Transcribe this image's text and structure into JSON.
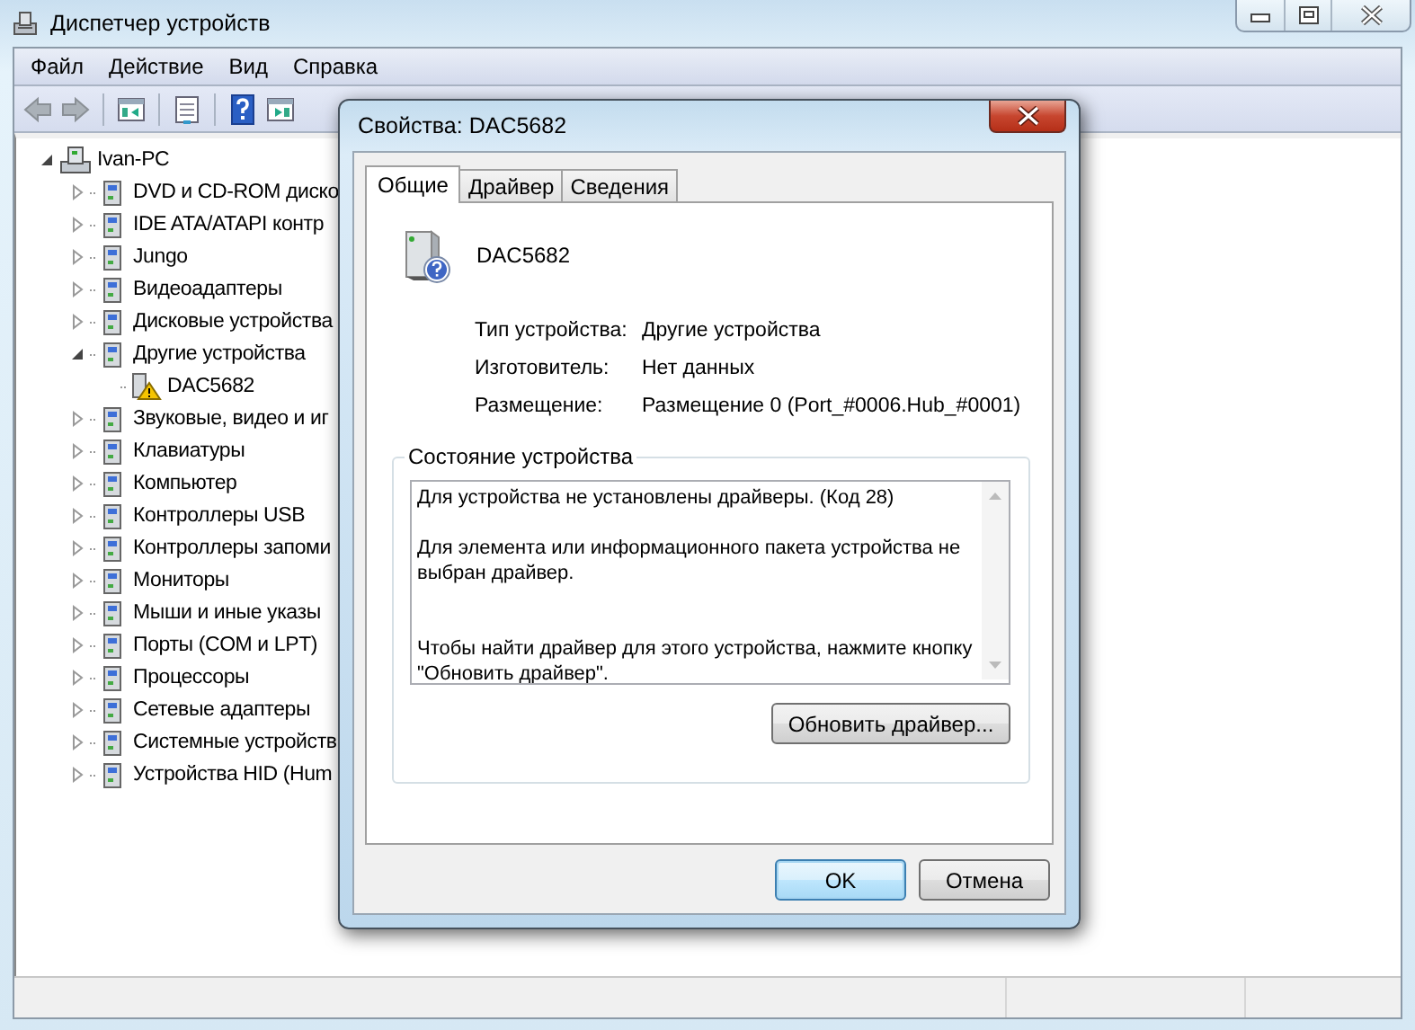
{
  "window": {
    "title": "Диспетчер устройств"
  },
  "menu": [
    "Файл",
    "Действие",
    "Вид",
    "Справка"
  ],
  "tree": {
    "label": "Ivan-PC",
    "expanded": true,
    "warning": false,
    "children": [
      {
        "label": "DVD и CD-ROM диско",
        "expanded": false,
        "warning": false
      },
      {
        "label": "IDE ATA/ATAPI контр",
        "expanded": false,
        "warning": false
      },
      {
        "label": "Jungo",
        "expanded": false,
        "warning": false
      },
      {
        "label": "Видеоадаптеры",
        "expanded": false,
        "warning": false
      },
      {
        "label": "Дисковые устройства",
        "expanded": false,
        "warning": false
      },
      {
        "label": "Другие устройства",
        "expanded": true,
        "warning": false,
        "children": [
          {
            "label": "DAC5682",
            "warning": true
          }
        ]
      },
      {
        "label": "Звуковые, видео и иг",
        "expanded": false,
        "warning": false
      },
      {
        "label": "Клавиатуры",
        "expanded": false,
        "warning": false
      },
      {
        "label": "Компьютер",
        "expanded": false,
        "warning": false
      },
      {
        "label": "Контроллеры USB",
        "expanded": false,
        "warning": false
      },
      {
        "label": "Контроллеры запоми",
        "expanded": false,
        "warning": false
      },
      {
        "label": "Мониторы",
        "expanded": false,
        "warning": false
      },
      {
        "label": "Мыши и иные указы",
        "expanded": false,
        "warning": false
      },
      {
        "label": "Порты (COM и LPT)",
        "expanded": false,
        "warning": false
      },
      {
        "label": "Процессоры",
        "expanded": false,
        "warning": false
      },
      {
        "label": "Сетевые адаптеры",
        "expanded": false,
        "warning": false
      },
      {
        "label": "Системные устройств",
        "expanded": false,
        "warning": false
      },
      {
        "label": "Устройства HID (Hum",
        "expanded": false,
        "warning": false
      }
    ]
  },
  "dialog": {
    "title": "Свойства: DAC5682",
    "tabs": [
      {
        "label": "Общие",
        "selected": true
      },
      {
        "label": "Драйвер",
        "selected": false
      },
      {
        "label": "Сведения",
        "selected": false
      }
    ],
    "device_name": "DAC5682",
    "properties": [
      {
        "label": "Тип устройства:",
        "value": "Другие устройства"
      },
      {
        "label": "Изготовитель:",
        "value": "Нет данных"
      },
      {
        "label": "Размещение:",
        "value": "Размещение 0 (Port_#0006.Hub_#0001)"
      }
    ],
    "status_group": {
      "title": "Состояние устройства",
      "text": "Для устройства не установлены драйверы. (Код 28)\n\nДля элемента или информационного пакета устройства не выбран драйвер.\n\n\nЧтобы найти драйвер для этого устройства, нажмите кнопку \"Обновить драйвер\".",
      "button": "Обновить драйвер..."
    },
    "buttons": [
      {
        "label": "OK",
        "default": true
      },
      {
        "label": "Отмена",
        "default": false
      }
    ]
  }
}
